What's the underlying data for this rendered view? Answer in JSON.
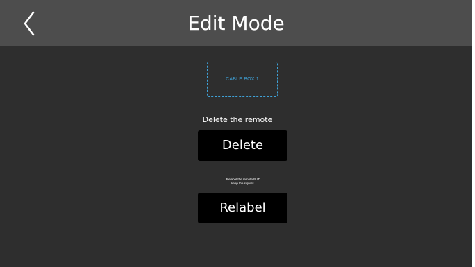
{
  "header": {
    "title": "Edit Mode",
    "back_icon": "chevron-left-icon"
  },
  "remote": {
    "name": "CABLE BOX 1",
    "border_color": "#3fa2d8"
  },
  "delete_section": {
    "description": "Delete the remote",
    "button_label": "Delete"
  },
  "relabel_section": {
    "description_line1": "Relabel the remote BUT",
    "description_line2": "keep the signals.",
    "button_label": "Relabel"
  },
  "colors": {
    "header_bg": "#4d4d4d",
    "screen_bg": "#2e2e2e",
    "button_bg": "#000000",
    "accent": "#3fa2d8"
  }
}
